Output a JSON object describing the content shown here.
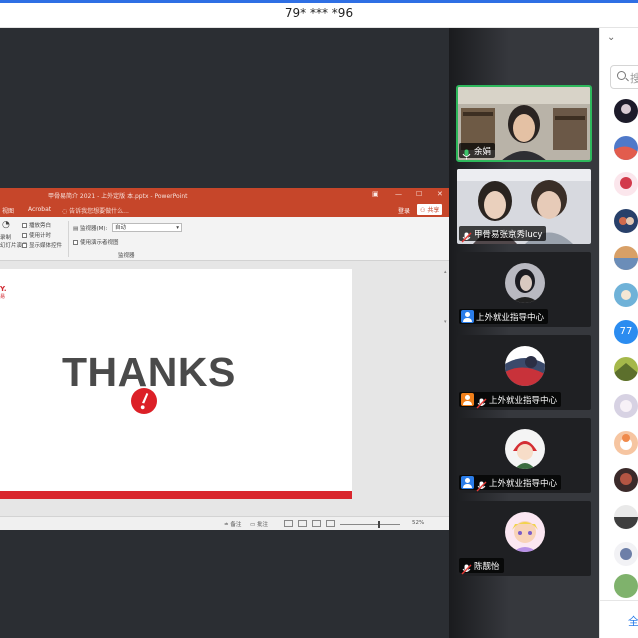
{
  "window": {
    "title": "79* *** *96"
  },
  "colors": {
    "accent_blue": "#2f6fe4",
    "ppt_red": "#c6462a",
    "slide_red": "#d9262d",
    "active_speaker": "#2eb85c"
  },
  "ppt": {
    "document_title": "甲骨易简介 2021 - 上外定版 本.pptx - PowerPoint",
    "tabs": [
      "视图",
      "Acrobat"
    ],
    "search_hint": "告诉我您想要做什么...",
    "login": "登录",
    "share": "共享",
    "ribbon": {
      "play_narration": "播放旁白",
      "use_timings": "使用计时",
      "show_media_controls": "显示媒体控件",
      "monitor_label": "监视器(M):",
      "monitor_value": "自动",
      "presenter_view": "使用演示者视图",
      "group_monitor": "监视器",
      "record": "录制",
      "slideshow": "幻灯片演示"
    },
    "slide": {
      "logo_text": "Y.",
      "logo_sub": "易",
      "headline": "THANKS"
    },
    "statusbar": {
      "notes": "≐ 备注",
      "comments": "▭ 批注",
      "zoom": "52%"
    }
  },
  "participants": [
    {
      "name": "余娟",
      "icon": "mic-green-icon"
    },
    {
      "name": "甲骨易张京秀lucy",
      "icon": "mic-muted-icon"
    },
    {
      "name": "上外就业指导中心",
      "icon": "user-badge-icon"
    },
    {
      "name": "上外就业指导中心",
      "icon": "mic-muted-icon"
    },
    {
      "name": "上外就业指导中心",
      "icon": "mic-muted-icon"
    },
    {
      "name": "陈靓怡",
      "icon": "mic-muted-icon"
    }
  ],
  "side_panel": {
    "search_placeholder": "搜",
    "member_count_badge": "77",
    "footer_label": "全"
  }
}
